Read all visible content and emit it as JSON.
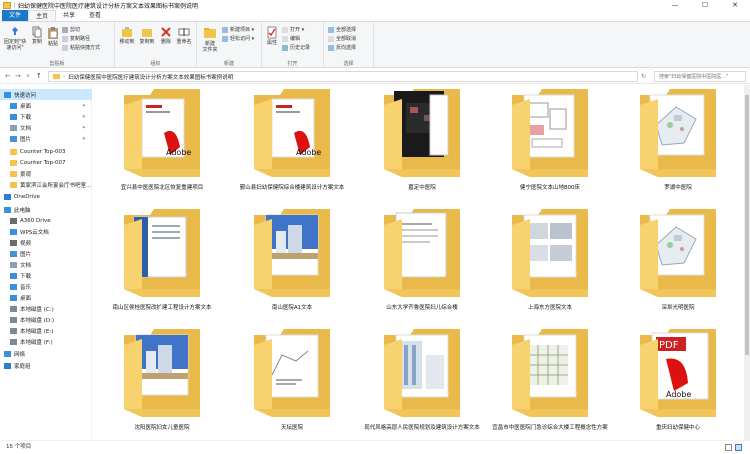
{
  "window": {
    "title": "妇幼保健医院中医院医疗建筑设计分析方案文本效果图标书案例说明",
    "controls": [
      "—",
      "☐",
      "✕"
    ]
  },
  "ribbon_tabs": [
    "文件",
    "主页",
    "共享",
    "查看"
  ],
  "ribbon": {
    "clipboard": {
      "label": "剪贴板",
      "pin_quick": "固定到\"快速访问\"",
      "copy": "复制",
      "paste": "粘贴",
      "copy_path": "复制路径",
      "paste_shortcut": "粘贴快捷方式",
      "cut": "剪切"
    },
    "organize": {
      "label": "组织",
      "move_to": "移动到",
      "copy_to": "复制到",
      "delete": "删除",
      "rename": "重命名"
    },
    "new": {
      "label": "新建",
      "new_folder": "新建\n文件夹",
      "new_item": "新建项目 ▾",
      "easy_access": "轻松访问 ▾"
    },
    "open": {
      "label": "打开",
      "properties": "属性",
      "open": "打开 ▾",
      "edit": "编辑",
      "history": "历史记录"
    },
    "select": {
      "label": "选择",
      "select_all": "全部选择",
      "select_none": "全部取消",
      "invert": "反向选择"
    }
  },
  "address": {
    "path": "妇幼保健医院中医院医疗建筑设计分析方案文本效果图标书案例说明",
    "search_placeholder": "搜索\"妇幼保健医院中医院医...\""
  },
  "sidebar": {
    "items": [
      {
        "label": "快速访问",
        "icon": "star-icon",
        "color": "#3c8fdc",
        "selected": true
      },
      {
        "label": "桌面",
        "icon": "desktop-icon",
        "color": "#3c8fdc",
        "pin": true
      },
      {
        "label": "下载",
        "icon": "download-icon",
        "color": "#3c8fdc",
        "pin": true
      },
      {
        "label": "文档",
        "icon": "document-icon",
        "color": "#8aa0b8",
        "pin": true
      },
      {
        "label": "图片",
        "icon": "picture-icon",
        "color": "#4a90d9",
        "pin": true
      },
      {
        "label": "Counter Top-003",
        "icon": "folder-icon",
        "color": "#f4c34a"
      },
      {
        "label": "Counter Top-007",
        "icon": "folder-icon",
        "color": "#f4c34a"
      },
      {
        "label": "景观",
        "icon": "folder-icon",
        "color": "#f4c34a"
      },
      {
        "label": "黄家滨江会所宴会厅书吧室...",
        "icon": "folder-icon",
        "color": "#f4c34a"
      },
      {
        "label": "OneDrive",
        "icon": "cloud-icon",
        "color": "#2b7cd3"
      },
      {
        "label": "此电脑",
        "icon": "computer-icon",
        "color": "#3c8fdc"
      },
      {
        "label": "A360 Drive",
        "icon": "a360-icon",
        "color": "#6b6b6b"
      },
      {
        "label": "WPS云文档",
        "icon": "cloud-doc-icon",
        "color": "#3c8fdc"
      },
      {
        "label": "视频",
        "icon": "video-icon",
        "color": "#6b6b6b"
      },
      {
        "label": "图片",
        "icon": "picture-icon",
        "color": "#4a90d9"
      },
      {
        "label": "文档",
        "icon": "document-icon",
        "color": "#8aa0b8"
      },
      {
        "label": "下载",
        "icon": "download-icon",
        "color": "#3c8fdc"
      },
      {
        "label": "音乐",
        "icon": "music-icon",
        "color": "#3c8fdc"
      },
      {
        "label": "桌面",
        "icon": "desktop-icon",
        "color": "#3c8fdc"
      },
      {
        "label": "本地磁盘 (C:)",
        "icon": "drive-icon",
        "color": "#7a8a99"
      },
      {
        "label": "本地磁盘 (D:)",
        "icon": "drive-icon",
        "color": "#7a8a99"
      },
      {
        "label": "本地磁盘 (E:)",
        "icon": "drive-icon",
        "color": "#7a8a99"
      },
      {
        "label": "本地磁盘 (F:)",
        "icon": "drive-icon",
        "color": "#7a8a99"
      },
      {
        "label": "网络",
        "icon": "network-icon",
        "color": "#3c8fdc"
      },
      {
        "label": "家庭组",
        "icon": "homegroup-icon",
        "color": "#2b7cd3"
      }
    ]
  },
  "folders": [
    {
      "label": "宜兴县中医医院北区恢复重建项目",
      "preview": "pdf-doc"
    },
    {
      "label": "鄞山县妇幼保健院综合楼建筑设计方案文本",
      "preview": "pdf-doc"
    },
    {
      "label": "嘉定中医院",
      "preview": "dark-brochure"
    },
    {
      "label": "健宁医院文本山地800床",
      "preview": "plans"
    },
    {
      "label": "罗湖中医院",
      "preview": "site-plan"
    },
    {
      "label": "南山区侯桂医院改扩建工程设计方案文本",
      "preview": "blue-doc"
    },
    {
      "label": "南山医院A1文本",
      "preview": "render-blue"
    },
    {
      "label": "山东大学齐鲁医院妇儿综合楼",
      "preview": "white-doc"
    },
    {
      "label": "上海东方医院文本",
      "preview": "render-gray"
    },
    {
      "label": "深圳光明医院",
      "preview": "site-plan"
    },
    {
      "label": "沈阳医院妇女儿童医院",
      "preview": "render-blue"
    },
    {
      "label": "天坛医院",
      "preview": "sketch"
    },
    {
      "label": "现代风格高层人民医院规划及建筑设计方案文本",
      "preview": "elevation"
    },
    {
      "label": "宜昌市中医医院门急诊综合大楼工程概念性方案",
      "preview": "facade"
    },
    {
      "label": "重庆妇幼保健中心",
      "preview": "pdf-big"
    }
  ],
  "status": {
    "count": "15 个项目"
  }
}
